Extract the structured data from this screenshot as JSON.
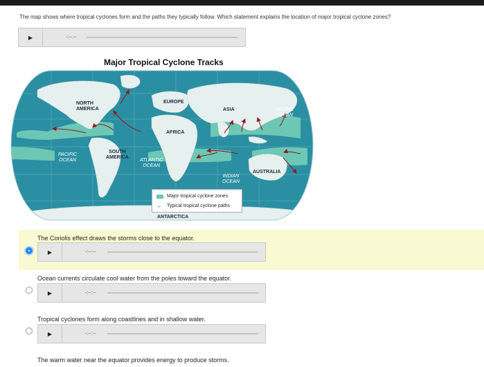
{
  "question": {
    "text": "The map shows where tropical cyclones form and the paths they typically follow. Which statement explains the location of major tropical cyclone zones?"
  },
  "audio": {
    "play_icon": "play-icon",
    "time": "-:--:--"
  },
  "map": {
    "title": "Major Tropical Cyclone Tracks",
    "labels": {
      "north_america": "NORTH\nAMERICA",
      "europe": "EUROPE",
      "asia": "ASIA",
      "africa": "AFRICA",
      "south_america": "SOUTH\nAMERICA",
      "australia": "AUSTRALIA",
      "antarctica": "ANTARCTICA",
      "pacific_left": "PACIFIC\nOCEAN",
      "pacific_right": "PACIFIC\nOCEAN",
      "atlantic": "ATLANTIC\nOCEAN",
      "indian": "INDIAN\nOCEAN"
    },
    "legend": {
      "zones": "Major tropical cyclone zones",
      "paths": "Typical tropical cyclone paths"
    },
    "colors": {
      "ocean": "#2b8fa3",
      "land": "#e6f0ee",
      "zone": "#6cc7b4",
      "path": "#8e1b2b"
    }
  },
  "choices": [
    {
      "text": "The Coriolis effect draws the storms close to the equator.",
      "selected": true
    },
    {
      "text": "Ocean currents circulate cool water from the poles toward the equator.",
      "selected": false
    },
    {
      "text": "Tropical cyclones form along coastlines and in shallow water.",
      "selected": false
    },
    {
      "text": "The warm water near the equator provides energy to produce storms.",
      "selected": false
    }
  ]
}
